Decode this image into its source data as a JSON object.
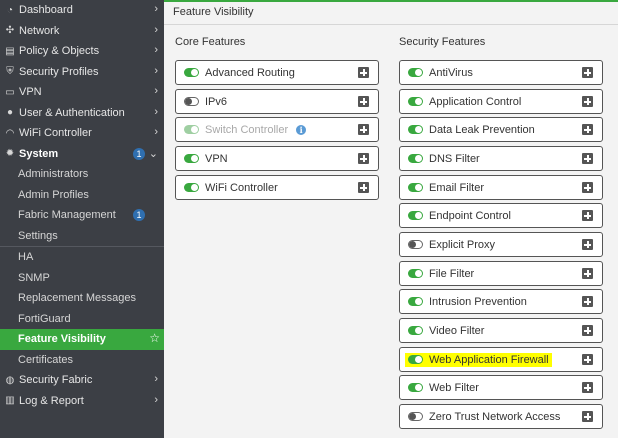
{
  "sidebar": {
    "items": [
      {
        "label": "Dashboard",
        "icon": "dashboard-icon"
      },
      {
        "label": "Network",
        "icon": "network-icon"
      },
      {
        "label": "Policy & Objects",
        "icon": "policy-icon"
      },
      {
        "label": "Security Profiles",
        "icon": "security-profile-icon"
      },
      {
        "label": "VPN",
        "icon": "vpn-icon"
      },
      {
        "label": "User & Authentication",
        "icon": "user-icon"
      },
      {
        "label": "WiFi Controller",
        "icon": "wifi-icon"
      },
      {
        "label": "System",
        "icon": "gear-icon",
        "badge": "1"
      }
    ],
    "system_sub": [
      {
        "label": "Administrators"
      },
      {
        "label": "Admin Profiles"
      },
      {
        "label": "Fabric Management",
        "badge": "1"
      },
      {
        "label": "Settings"
      },
      {
        "label": "HA"
      },
      {
        "label": "SNMP"
      },
      {
        "label": "Replacement Messages"
      },
      {
        "label": "FortiGuard"
      },
      {
        "label": "Feature Visibility"
      },
      {
        "label": "Certificates"
      }
    ],
    "bottom": [
      {
        "label": "Security Fabric",
        "icon": "fabric-icon"
      },
      {
        "label": "Log & Report",
        "icon": "report-icon"
      }
    ]
  },
  "main": {
    "title": "Feature Visibility",
    "core_heading": "Core Features",
    "security_heading": "Security Features",
    "core": [
      {
        "label": "Advanced Routing",
        "state": "on"
      },
      {
        "label": "IPv6",
        "state": "off"
      },
      {
        "label": "Switch Controller",
        "state": "disabled"
      },
      {
        "label": "VPN",
        "state": "on"
      },
      {
        "label": "WiFi Controller",
        "state": "on"
      }
    ],
    "security": [
      {
        "label": "AntiVirus",
        "state": "on"
      },
      {
        "label": "Application Control",
        "state": "on"
      },
      {
        "label": "Data Leak Prevention",
        "state": "on"
      },
      {
        "label": "DNS Filter",
        "state": "on"
      },
      {
        "label": "Email Filter",
        "state": "on"
      },
      {
        "label": "Endpoint Control",
        "state": "on"
      },
      {
        "label": "Explicit Proxy",
        "state": "off"
      },
      {
        "label": "File Filter",
        "state": "on"
      },
      {
        "label": "Intrusion Prevention",
        "state": "on"
      },
      {
        "label": "Video Filter",
        "state": "on"
      },
      {
        "label": "Web Application Firewall",
        "state": "on",
        "highlighted": true
      },
      {
        "label": "Web Filter",
        "state": "on"
      },
      {
        "label": "Zero Trust Network Access",
        "state": "off"
      }
    ]
  },
  "colors": {
    "accent": "#39a83f",
    "sidebar_bg": "#3c3f45",
    "highlight": "#ffff00",
    "badge": "#2f6fb0"
  }
}
